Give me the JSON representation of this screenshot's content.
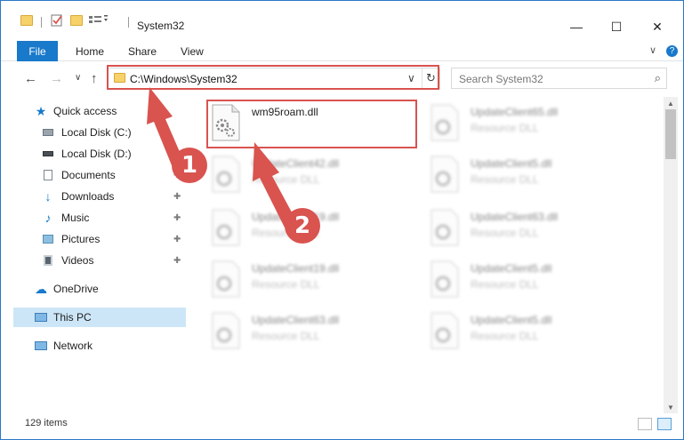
{
  "window": {
    "title": "System32",
    "controls": {
      "minimize": "—",
      "maximize": "☐",
      "close": "✕"
    }
  },
  "ribbon": {
    "tabs": [
      "File",
      "Home",
      "Share",
      "View"
    ],
    "help_glyph": "?",
    "expand_glyph": "∨"
  },
  "nav": {
    "back": "←",
    "forward": "→",
    "recent": "∨",
    "up": "↑"
  },
  "address": {
    "path": "C:\\Windows\\System32",
    "dropdown": "∨",
    "refresh": "↻"
  },
  "search": {
    "placeholder": "Search System32",
    "icon_glyph": "⌕"
  },
  "sidebar": {
    "items": [
      {
        "label": "Quick access",
        "icon": "star-icon",
        "pinned": false
      },
      {
        "label": "Local Disk (C:)",
        "icon": "drive-icon",
        "pinned": false
      },
      {
        "label": "Local Disk (D:)",
        "icon": "drive-icon",
        "pinned": true
      },
      {
        "label": "Documents",
        "icon": "document-icon",
        "pinned": true
      },
      {
        "label": "Downloads",
        "icon": "download-icon",
        "pinned": true
      },
      {
        "label": "Music",
        "icon": "music-icon",
        "pinned": true
      },
      {
        "label": "Pictures",
        "icon": "picture-icon",
        "pinned": true
      },
      {
        "label": "Videos",
        "icon": "video-icon",
        "pinned": true
      },
      {
        "label": "OneDrive",
        "icon": "cloud-icon",
        "pinned": false
      },
      {
        "label": "This PC",
        "icon": "computer-icon",
        "pinned": false,
        "selected": true
      },
      {
        "label": "Network",
        "icon": "network-icon",
        "pinned": false
      }
    ],
    "pin_glyph": "📌"
  },
  "files": [
    {
      "name": "wm95roam.dll",
      "type": "",
      "highlighted": true
    },
    {
      "name": "UpdateClient65.dll",
      "type": "Resource DLL",
      "highlighted": false
    },
    {
      "name": "UpdateClient42.dll",
      "type": "Resource DLL",
      "highlighted": false
    },
    {
      "name": "UpdateClient5.dll",
      "type": "Resource DLL",
      "highlighted": false
    },
    {
      "name": "UpdateClient19.dll",
      "type": "Resource DLL",
      "highlighted": false
    },
    {
      "name": "UpdateClient63.dll",
      "type": "Resource DLL",
      "highlighted": false
    },
    {
      "name": "UpdateClient19.dll",
      "type": "Resource DLL",
      "highlighted": false
    },
    {
      "name": "UpdateClient5.dll",
      "type": "Resource DLL",
      "highlighted": false
    },
    {
      "name": "UpdateClient63.dll",
      "type": "Resource DLL",
      "highlighted": false
    },
    {
      "name": "UpdateClient5.dll",
      "type": "Resource DLL",
      "highlighted": false
    }
  ],
  "status": {
    "item_count": "129 items"
  },
  "annotations": {
    "step1": "1",
    "step2": "2",
    "color": "#d9534f"
  },
  "colors": {
    "accent": "#1979ca",
    "selection": "#cde6f7",
    "highlight": "#d9534f"
  }
}
